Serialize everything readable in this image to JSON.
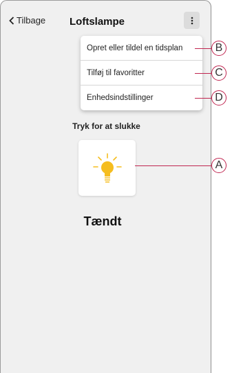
{
  "header": {
    "back_label": "Tilbage",
    "title": "Loftslampe"
  },
  "menu": {
    "items": [
      {
        "label": "Opret eller tildel en tidsplan"
      },
      {
        "label": "Tilføj til favoritter"
      },
      {
        "label": "Enhedsindstillinger"
      }
    ]
  },
  "main": {
    "instruction": "Tryk for at slukke",
    "status": "Tændt"
  },
  "callouts": [
    "A",
    "B",
    "C",
    "D"
  ],
  "colors": {
    "callout": "#c0244f",
    "bulb": "#f5bd1f"
  }
}
